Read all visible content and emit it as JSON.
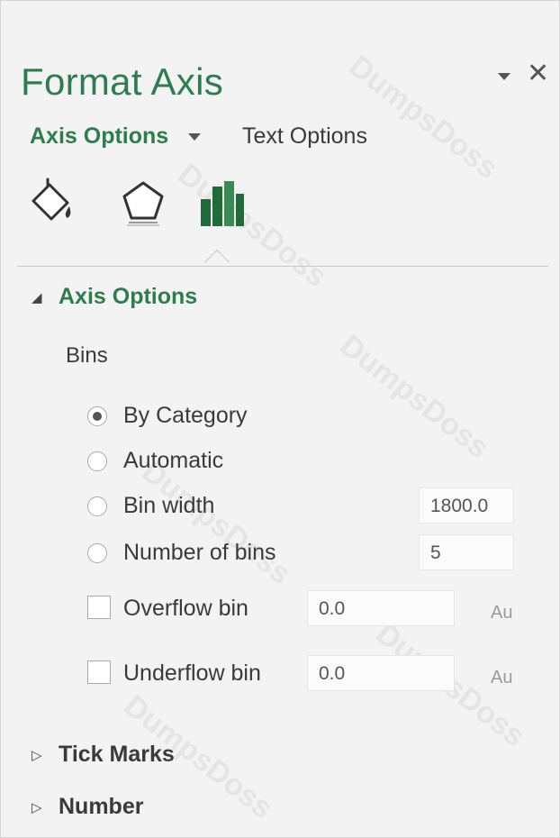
{
  "pane": {
    "title": "Format Axis",
    "close_symbol": "✕",
    "accent_color": "#2e7d4f"
  },
  "option_tabs": {
    "axis_options": "Axis Options",
    "text_options": "Text Options"
  },
  "icons": [
    "fill-line-icon",
    "effects-pentagon-icon",
    "axis-options-bars-icon"
  ],
  "axis_options_section": {
    "title": "Axis Options",
    "expanded": true,
    "bins_label": "Bins",
    "radios": [
      {
        "label": "By Category",
        "checked": true
      },
      {
        "label": "Automatic",
        "checked": false
      },
      {
        "label": "Bin width",
        "checked": false,
        "value": "1800.0"
      },
      {
        "label": "Number of bins",
        "checked": false,
        "value": "5"
      }
    ],
    "overflow": {
      "label": "Overflow bin",
      "value": "0.0",
      "auto_label": "Au",
      "checked": false
    },
    "underflow": {
      "label": "Underflow bin",
      "value": "0.0",
      "auto_label": "Au",
      "checked": false
    }
  },
  "collapsed_sections": [
    {
      "title": "Tick Marks"
    },
    {
      "title": "Number"
    }
  ],
  "watermark": "DumpsDoss"
}
